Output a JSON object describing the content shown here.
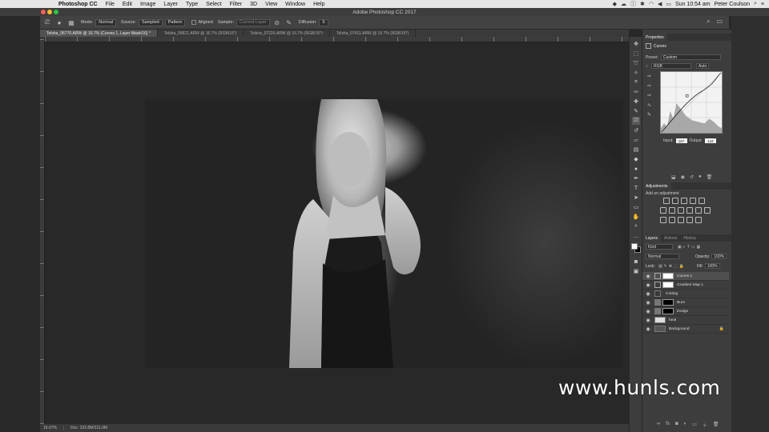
{
  "menubar": {
    "app": "Photoshop CC",
    "items": [
      "File",
      "Edit",
      "Image",
      "Layer",
      "Type",
      "Select",
      "Filter",
      "3D",
      "View",
      "Window",
      "Help"
    ],
    "clock": "Sun 10:54 am",
    "user": "Peter Coulson"
  },
  "window": {
    "title": "Adobe Photoshop CC 2017"
  },
  "options": {
    "mode_label": "Mode:",
    "mode_value": "Normal",
    "source_label": "Source:",
    "source_sampled": "Sampled",
    "source_pattern": "Pattern",
    "aligned_label": "Aligned",
    "sample_label": "Sample:",
    "sample_value": "Current Layer",
    "diffusion_label": "Diffusion:",
    "diffusion_value": "5"
  },
  "tabs": [
    "Telsha_06770.ARW @ 16.7% (Curves 1, Layer Mask/16) *",
    "Telsha_06821.ARW @ 16.7% (RGB/16*)",
    "Telsha_07226.ARW @ 16.7% (RGB/16*)",
    "Telsha_07411.ARW @ 16.7% (RGB/16*)"
  ],
  "status": {
    "zoom": "16.67%",
    "doc": "Doc: 333.8M/211.6M"
  },
  "properties": {
    "tab": "Properties",
    "title": "Curves",
    "preset_label": "Preset:",
    "preset_value": "Custom",
    "channel_value": "RGB",
    "auto_label": "Auto",
    "input_label": "Input:",
    "input_value": "167",
    "output_label": "Output:",
    "output_value": "144"
  },
  "adjustments": {
    "tab": "Adjustments",
    "subtitle": "Add an adjustment"
  },
  "layers_panel": {
    "tabs": [
      "Layers",
      "Actions",
      "History"
    ],
    "kind_label": "Kind",
    "blend_mode": "Normal",
    "opacity_label": "Opacity:",
    "opacity_value": "100%",
    "lock_label": "Lock:",
    "fill_label": "Fill:",
    "fill_value": "100%",
    "layers": [
      {
        "name": "Curves 1",
        "selected": true
      },
      {
        "name": "Gradient Map 1",
        "selected": false
      },
      {
        "name": "Cutting",
        "selected": false
      },
      {
        "name": "Burn",
        "selected": false
      },
      {
        "name": "Dodge",
        "selected": false
      },
      {
        "name": "heal",
        "selected": false
      },
      {
        "name": "Background",
        "selected": false
      }
    ]
  },
  "watermark": "www.hunls.com",
  "colors": {
    "foreground": "#ffffff",
    "background": "#000000",
    "ui_dark": "#3d3d3d"
  }
}
